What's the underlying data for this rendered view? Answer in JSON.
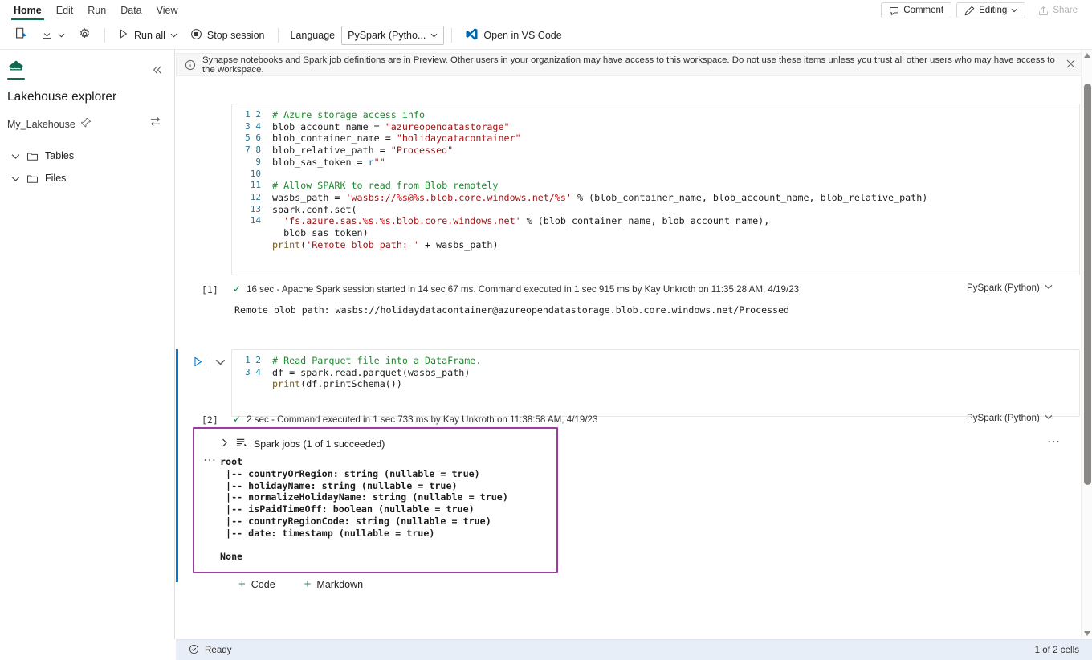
{
  "ribbon": {
    "tabs": [
      {
        "label": "Home",
        "active": true
      },
      {
        "label": "Edit",
        "active": false
      },
      {
        "label": "Run",
        "active": false
      },
      {
        "label": "Data",
        "active": false
      },
      {
        "label": "View",
        "active": false
      }
    ],
    "comment_label": "Comment",
    "editing_label": "Editing",
    "share_label": "Share"
  },
  "commandbar": {
    "edit_notebook_icon": "notebook-edit-icon",
    "download_icon": "download-icon",
    "settings_icon": "gear-icon",
    "run_all_label": "Run all",
    "stop_session_label": "Stop session",
    "language_label": "Language",
    "language_value": "PySpark (Pytho...",
    "vscode_label": "Open in VS Code"
  },
  "sidebar": {
    "title": "Lakehouse explorer",
    "lakehouse_name": "My_Lakehouse",
    "pin_icon": "pin-icon",
    "swap_icon": "swap-icon",
    "collapse_icon": "chevron-double-left-icon",
    "items": [
      {
        "label": "Tables"
      },
      {
        "label": "Files"
      }
    ]
  },
  "banner": {
    "text": "Synapse notebooks and Spark job definitions are in Preview. Other users in your organization may have access to this workspace. Do not use these items unless you trust all other users who may have access to the workspace.",
    "info_icon": "info-icon",
    "close_icon": "close-icon"
  },
  "cells": [
    {
      "index_label": "[1]",
      "line_numbers": "1\n2\n3\n4\n5\n6\n7\n8\n9\n10\n11\n12\n13\n14",
      "status_text": "16 sec - Apache Spark session started in 14 sec 67 ms. Command executed in 1 sec 915 ms by Kay Unkroth on 11:35:28 AM, 4/19/23",
      "language": "PySpark (Python)",
      "output": "Remote blob path: wasbs://holidaydatacontainer@azureopendatastorage.blob.core.windows.net/Processed"
    },
    {
      "index_label": "[2]",
      "line_numbers": "1\n2\n3\n4",
      "status_text": "2 sec - Command executed in 1 sec 733 ms by Kay Unkroth on 11:38:58 AM, 4/19/23",
      "language": "PySpark (Python)",
      "spark_jobs_label": "Spark jobs (1 of 1 succeeded)",
      "output": "root\n |-- countryOrRegion: string (nullable = true)\n |-- holidayName: string (nullable = true)\n |-- normalizeHolidayName: string (nullable = true)\n |-- isPaidTimeOff: boolean (nullable = true)\n |-- countryRegionCode: string (nullable = true)\n |-- date: timestamp (nullable = true)\n\nNone"
    }
  ],
  "cell_toolbar": {
    "icons": [
      "convert-to-markdown-icon",
      "clear-output-icon",
      "add-comment-icon",
      "more-options-icon",
      "delete-cell-icon"
    ]
  },
  "add_cell": {
    "code_label": "Code",
    "markdown_label": "Markdown"
  },
  "statusbar": {
    "ready_label": "Ready",
    "cells_label": "1 of 2 cells",
    "status_icon": "check-circle-icon"
  },
  "colors": {
    "accent_green": "#0f6a4f",
    "selection_blue": "#0078d4",
    "highlight_purple": "#9c3c9c",
    "statusbar_bg": "#e8eef7"
  }
}
